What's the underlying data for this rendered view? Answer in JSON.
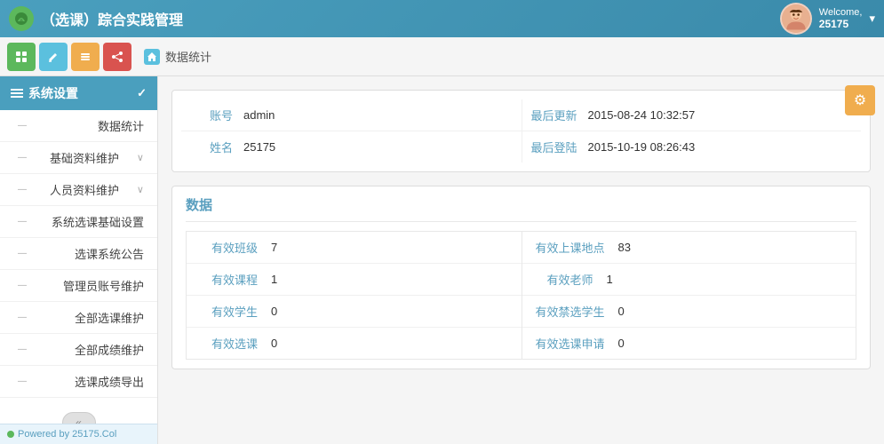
{
  "header": {
    "logo_text": "🌿",
    "title": "（选课）踪合实践管理",
    "welcome_label": "Welcome,",
    "username": "25175",
    "dropdown": "▾"
  },
  "toolbar": {
    "btn1": "▦",
    "btn2": "✎",
    "btn3": "▤",
    "btn4": "✦",
    "home_icon": "⌂",
    "breadcrumb_sep": "",
    "breadcrumb_current": "数据统计"
  },
  "sidebar": {
    "header_label": "系统设置",
    "collapse_icon": "✓",
    "items": [
      {
        "label": "数据统计",
        "indent": false,
        "arrow": false
      },
      {
        "label": "基础资料维护",
        "indent": false,
        "arrow": true
      },
      {
        "label": "人员资料维护",
        "indent": false,
        "arrow": true
      },
      {
        "label": "系统选课基础设置",
        "indent": false,
        "arrow": false
      },
      {
        "label": "选课系统公告",
        "indent": false,
        "arrow": false
      },
      {
        "label": "管理员账号维护",
        "indent": false,
        "arrow": false
      },
      {
        "label": "全部选课维护",
        "indent": false,
        "arrow": false
      },
      {
        "label": "全部成绩维护",
        "indent": false,
        "arrow": false
      },
      {
        "label": "选课成绩导出",
        "indent": false,
        "arrow": false
      }
    ],
    "collapse_btn": "«",
    "footer_text": "Powered by 25175.Col"
  },
  "content": {
    "settings_icon": "⚙",
    "info": {
      "label_account": "账号",
      "value_account": "admin",
      "label_name": "姓名",
      "value_name": "25175",
      "label_last_update": "最后更新",
      "value_last_update": "2015-08-24 10:32:57",
      "label_last_login": "最后登陆",
      "value_last_login": "2015-10-19 08:26:43"
    },
    "data_section": {
      "title": "数据",
      "rows": [
        {
          "label": "有效班级",
          "value": "7",
          "label_r": "有效上课地点",
          "value_r": "83"
        },
        {
          "label": "有效课程",
          "value": "1",
          "label_r": "有效老师",
          "value_r": "1"
        },
        {
          "label": "有效学生",
          "value": "0",
          "label_r": "有效禁选学生",
          "value_r": "0"
        },
        {
          "label": "有效选课",
          "value": "0",
          "label_r": "有效选课申请",
          "value_r": "0"
        }
      ]
    }
  }
}
